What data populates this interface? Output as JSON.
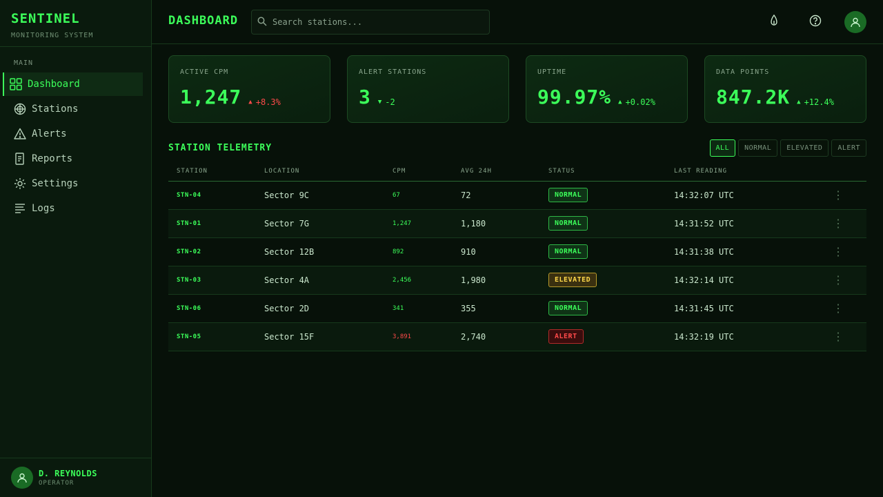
{
  "brand": {
    "title": "SENTINEL",
    "subtitle": "MONITORING SYSTEM"
  },
  "nav": {
    "section": "MAIN",
    "items": [
      {
        "label": "Dashboard",
        "icon": "grid-icon",
        "active": true
      },
      {
        "label": "Stations",
        "icon": "radar-icon"
      },
      {
        "label": "Alerts",
        "icon": "warning-icon"
      },
      {
        "label": "Reports",
        "icon": "document-icon"
      },
      {
        "label": "Settings",
        "icon": "gear-icon"
      },
      {
        "label": "Logs",
        "icon": "list-icon"
      }
    ]
  },
  "user": {
    "name": "D. REYNOLDS",
    "role": "OPERATOR"
  },
  "header": {
    "title": "DASHBOARD",
    "search_placeholder": "Search stations..."
  },
  "stats": [
    {
      "label": "ACTIVE CPM",
      "value": "1,247",
      "trend": "+8.3%",
      "direction": "up",
      "color": "#ff4a4a"
    },
    {
      "label": "ALERT STATIONS",
      "value": "3",
      "trend": "-2",
      "direction": "down",
      "color": "#3cff5a"
    },
    {
      "label": "UPTIME",
      "value": "99.97%",
      "trend": "+0.02%",
      "direction": "up",
      "color": "#3cff5a"
    },
    {
      "label": "DATA POINTS",
      "value": "847.2K",
      "trend": "+12.4%",
      "direction": "up",
      "color": "#3cff5a"
    }
  ],
  "telemetry": {
    "title": "STATION TELEMETRY",
    "filters": [
      "ALL",
      "NORMAL",
      "ELEVATED",
      "ALERT"
    ],
    "active_filter": "ALL",
    "columns": [
      "STATION",
      "LOCATION",
      "CPM",
      "AVG 24H",
      "STATUS",
      "LAST READING"
    ],
    "rows": [
      {
        "station": "STN-04",
        "location": "Sector 9C",
        "cpm": "67",
        "avg": "72",
        "status": "NORMAL",
        "last": "14:32:07 UTC"
      },
      {
        "station": "STN-01",
        "location": "Sector 7G",
        "cpm": "1,247",
        "avg": "1,180",
        "status": "NORMAL",
        "last": "14:31:52 UTC"
      },
      {
        "station": "STN-02",
        "location": "Sector 12B",
        "cpm": "892",
        "avg": "910",
        "status": "NORMAL",
        "last": "14:31:38 UTC"
      },
      {
        "station": "STN-03",
        "location": "Sector 4A",
        "cpm": "2,456",
        "avg": "1,980",
        "status": "ELEVATED",
        "last": "14:32:14 UTC"
      },
      {
        "station": "STN-06",
        "location": "Sector 2D",
        "cpm": "341",
        "avg": "355",
        "status": "NORMAL",
        "last": "14:31:45 UTC"
      },
      {
        "station": "STN-05",
        "location": "Sector 15F",
        "cpm": "3,891",
        "avg": "2,740",
        "status": "ALERT",
        "last": "14:32:19 UTC"
      }
    ]
  },
  "colors": {
    "accent": "#3cff5a",
    "alert": "#ff4a4a",
    "elevated": "#ffd84a",
    "background": "#071109"
  }
}
